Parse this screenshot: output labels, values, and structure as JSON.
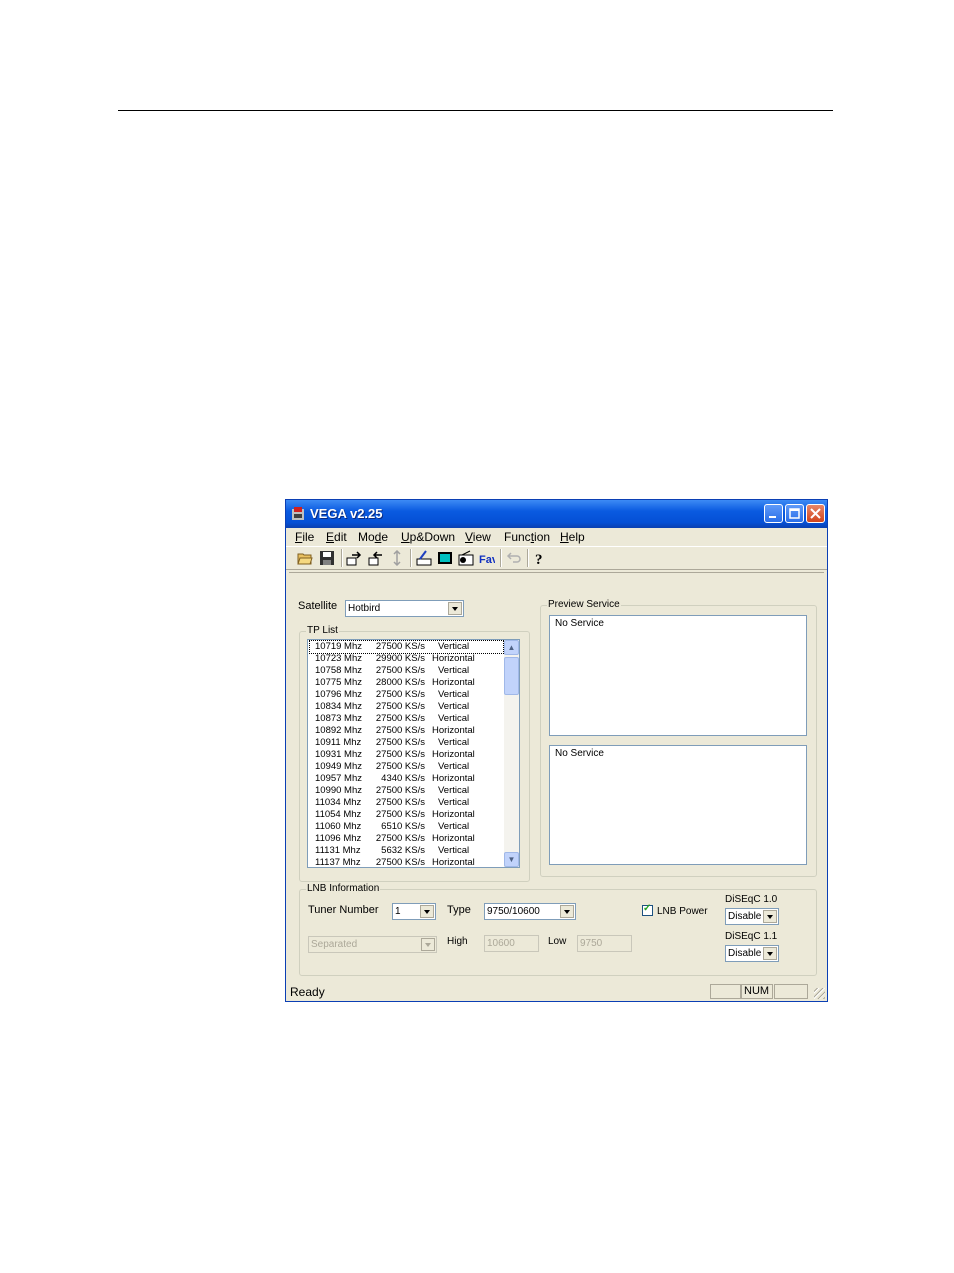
{
  "window": {
    "title": "VEGA v2.25"
  },
  "menu": [
    "File",
    "Edit",
    "Mode",
    "Up&Down",
    "View",
    "Function",
    "Help"
  ],
  "menu_mnemonic_index": [
    0,
    0,
    2,
    0,
    0,
    4,
    0
  ],
  "toolbar_icons": [
    "open-folder-icon",
    "save-icon",
    "upload-icon",
    "download-icon",
    "transfer-icon",
    "satellite-edit-icon",
    "tv-icon",
    "radio-icon",
    "fav-icon",
    "undo-icon",
    "help-icon"
  ],
  "satellite": {
    "label": "Satellite",
    "value": "Hotbird"
  },
  "tp_list": {
    "title": "TP List",
    "rows": [
      [
        "10719 Mhz",
        "27500 KS/s",
        "Vertical"
      ],
      [
        "10723 Mhz",
        "29900 KS/s",
        "Horizontal"
      ],
      [
        "10758 Mhz",
        "27500 KS/s",
        "Vertical"
      ],
      [
        "10775 Mhz",
        "28000 KS/s",
        "Horizontal"
      ],
      [
        "10796 Mhz",
        "27500 KS/s",
        "Vertical"
      ],
      [
        "10834 Mhz",
        "27500 KS/s",
        "Vertical"
      ],
      [
        "10873 Mhz",
        "27500 KS/s",
        "Vertical"
      ],
      [
        "10892 Mhz",
        "27500 KS/s",
        "Horizontal"
      ],
      [
        "10911 Mhz",
        "27500 KS/s",
        "Vertical"
      ],
      [
        "10931 Mhz",
        "27500 KS/s",
        "Horizontal"
      ],
      [
        "10949 Mhz",
        "27500 KS/s",
        "Vertical"
      ],
      [
        "10957 Mhz",
        "4340 KS/s",
        "Horizontal"
      ],
      [
        "10990 Mhz",
        "27500 KS/s",
        "Vertical"
      ],
      [
        "11034 Mhz",
        "27500 KS/s",
        "Vertical"
      ],
      [
        "11054 Mhz",
        "27500 KS/s",
        "Horizontal"
      ],
      [
        "11060 Mhz",
        "6510 KS/s",
        "Vertical"
      ],
      [
        "11096 Mhz",
        "27500 KS/s",
        "Horizontal"
      ],
      [
        "11131 Mhz",
        "5632 KS/s",
        "Vertical"
      ],
      [
        "11137 Mhz",
        "27500 KS/s",
        "Horizontal"
      ]
    ]
  },
  "preview": {
    "title": "Preview Service",
    "top_text": "No Service",
    "bottom_text": "No Service"
  },
  "lnb": {
    "title": "LNB Information",
    "tuner_label": "Tuner Number",
    "tuner_value": "1",
    "type_label": "Type",
    "type_value": "9750/10600",
    "power_label": "LNB Power",
    "mode_value": "Separated",
    "high_label": "High",
    "high_value": "10600",
    "low_label": "Low",
    "low_value": "9750",
    "diseqc10_label": "DiSEqC 1.0",
    "diseqc10_value": "Disable",
    "diseqc11_label": "DiSEqC 1.1",
    "diseqc11_value": "Disable"
  },
  "status": {
    "text": "Ready",
    "num": "NUM"
  }
}
